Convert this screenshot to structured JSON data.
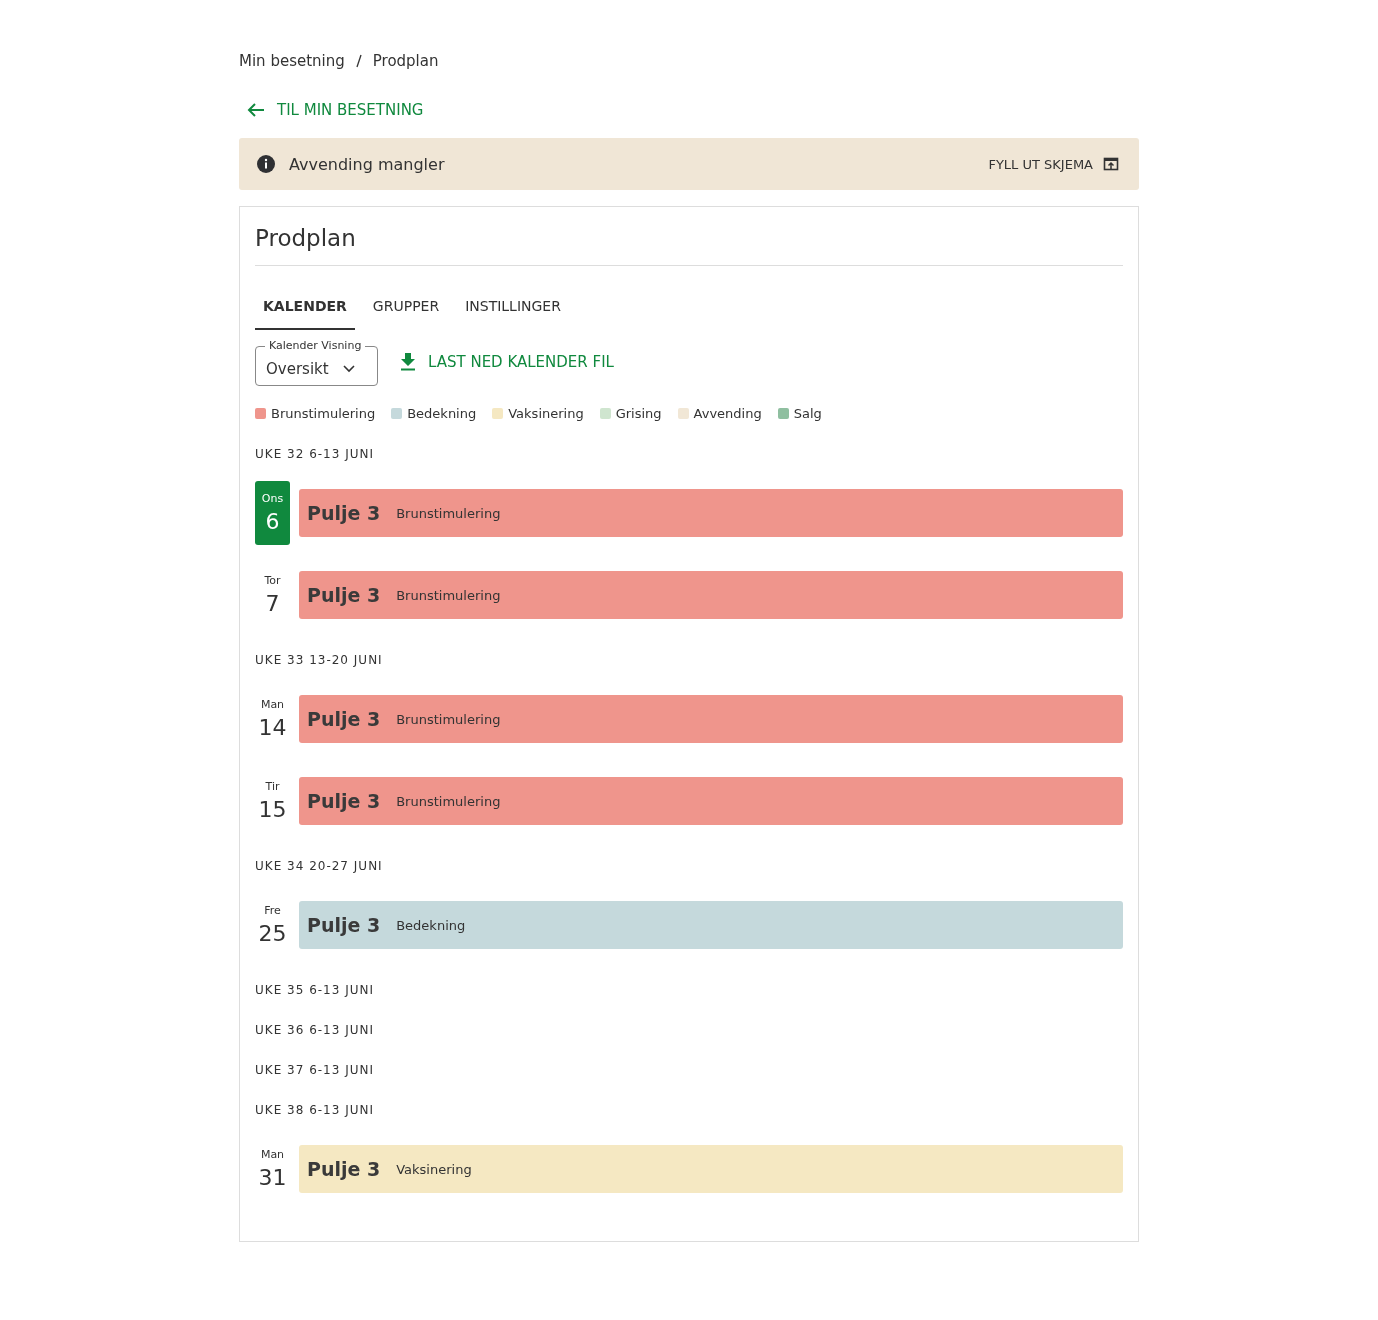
{
  "breadcrumb": [
    "Min besetning",
    "Prodplan"
  ],
  "back_link": {
    "label": "TIL MIN BESETNING"
  },
  "alert": {
    "message": "Avvending mangler",
    "action": "FYLL UT SKJEMA"
  },
  "card": {
    "title": "Prodplan",
    "tabs": [
      {
        "label": "KALENDER",
        "selected": true
      },
      {
        "label": "GRUPPER",
        "selected": false
      },
      {
        "label": "INSTILLINGER",
        "selected": false
      }
    ],
    "view_select": {
      "label": "Kalender Visning",
      "value": "Oversikt"
    },
    "download": {
      "label": "LAST NED KALENDER FIL"
    },
    "legend": [
      {
        "label": "Brunstimulering",
        "color": "#ef958c"
      },
      {
        "label": "Bedekning",
        "color": "#c5d9dc"
      },
      {
        "label": "Vaksinering",
        "color": "#f5e8c2"
      },
      {
        "label": "Grising",
        "color": "#cfe5cf"
      },
      {
        "label": "Avvending",
        "color": "#f1e7d6"
      },
      {
        "label": "Salg",
        "color": "#8fbfa0"
      }
    ],
    "weeks": [
      {
        "heading": "UKE 32 6-13 JUNI",
        "days": [
          {
            "weekday": "Ons",
            "day": "6",
            "selected": true,
            "group": "Pulje 3",
            "event": "Brunstimulering",
            "color": "#ef958c"
          },
          {
            "weekday": "Tor",
            "day": "7",
            "selected": false,
            "group": "Pulje 3",
            "event": "Brunstimulering",
            "color": "#ef958c"
          }
        ]
      },
      {
        "heading": "UKE 33 13-20 JUNI",
        "days": [
          {
            "weekday": "Man",
            "day": "14",
            "selected": false,
            "group": "Pulje 3",
            "event": "Brunstimulering",
            "color": "#ef958c"
          },
          {
            "weekday": "Tir",
            "day": "15",
            "selected": false,
            "group": "Pulje 3",
            "event": "Brunstimulering",
            "color": "#ef958c"
          }
        ]
      },
      {
        "heading": "UKE 34 20-27 JUNI",
        "days": [
          {
            "weekday": "Fre",
            "day": "25",
            "selected": false,
            "group": "Pulje 3",
            "event": "Bedekning",
            "color": "#c5d9dc"
          }
        ]
      },
      {
        "heading": "UKE 35 6-13 JUNI"
      },
      {
        "heading": "UKE 36 6-13 JUNI"
      },
      {
        "heading": "UKE 37 6-13 JUNI"
      },
      {
        "heading": "UKE 38 6-13 JUNI",
        "days": [
          {
            "weekday": "Man",
            "day": "31",
            "selected": false,
            "group": "Pulje 3",
            "event": "Vaksinering",
            "color": "#f5e8c2"
          }
        ]
      }
    ]
  }
}
